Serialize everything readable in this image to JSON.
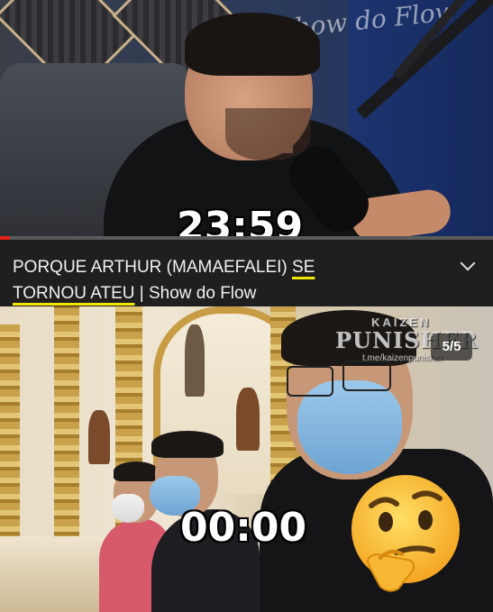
{
  "top_panel": {
    "timestamp": "23:59",
    "watermark": "Show do Flow"
  },
  "video_title": {
    "part1": "PORQUE ARTHUR (MAMAEFALEI) ",
    "underlined1": "SE",
    "underlined2": "TORNOU ATEU",
    "part2": " | Show do Flow",
    "progress_percent": 2,
    "expand_icon": "chevron-down-icon"
  },
  "bottom_panel": {
    "timestamp": "00:00",
    "slide_badge": "5/5",
    "watermark_top": "KAIZEN",
    "watermark_main": "PUNISHER",
    "watermark_url": "t.me/kaizenpunisher"
  },
  "emoji": "thinking-face-emoji",
  "colors": {
    "highlight_underline": "#f2e600",
    "progress": "#e62117",
    "titlebar_bg": "#1f1f1f"
  }
}
